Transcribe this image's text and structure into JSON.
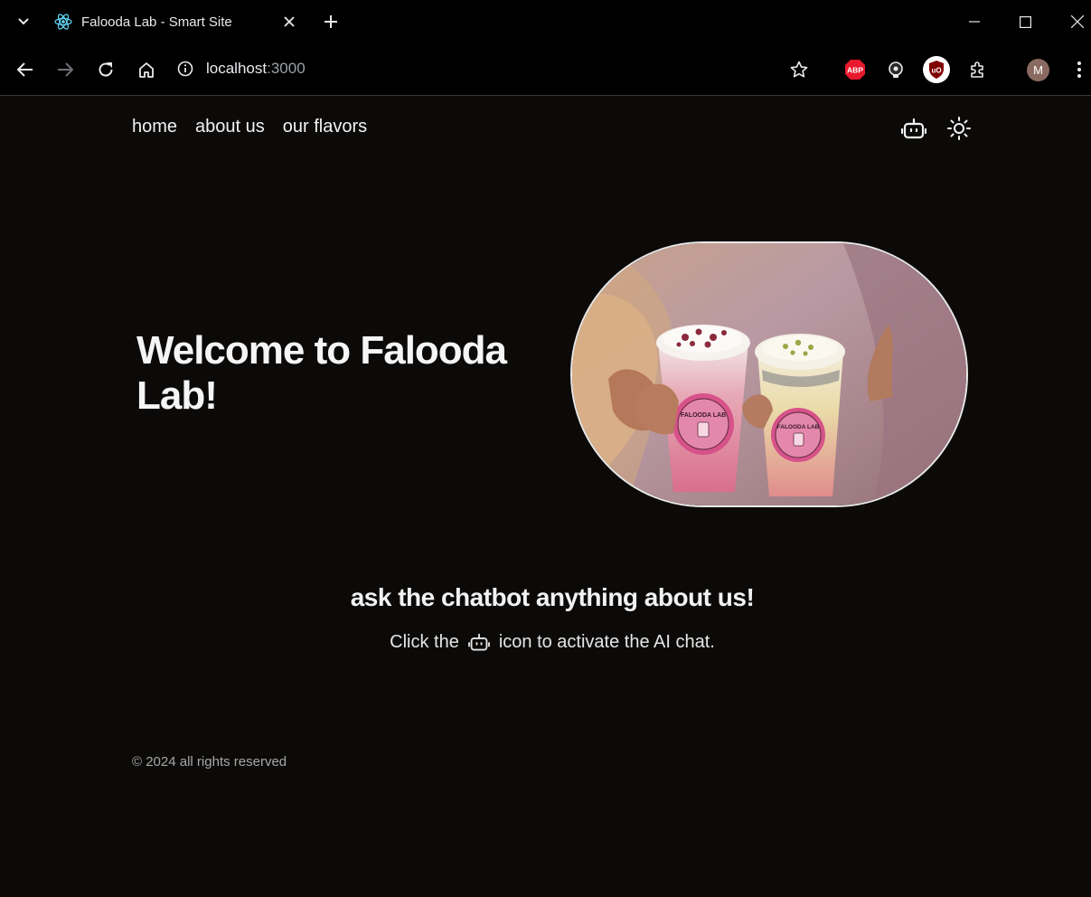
{
  "browser": {
    "tab_title": "Falooda Lab - Smart Site",
    "url_host": "localhost",
    "url_port": ":3000",
    "profile_initial": "M",
    "abp_label": "ABP",
    "ublock_label": "uO"
  },
  "nav": {
    "items": [
      "home",
      "about us",
      "our flavors"
    ]
  },
  "hero": {
    "title": "Welcome to Falooda Lab!",
    "cup_label": "FALOODA LAB"
  },
  "cta": {
    "title": "ask the chatbot anything about us!",
    "sub_before": "Click the",
    "sub_after": "icon to activate the AI chat."
  },
  "footer": {
    "text": "© 2024 all rights reserved"
  },
  "colors": {
    "background": "#0b0a09",
    "text": "#f2f2f2",
    "muted": "#a8a8a8"
  }
}
